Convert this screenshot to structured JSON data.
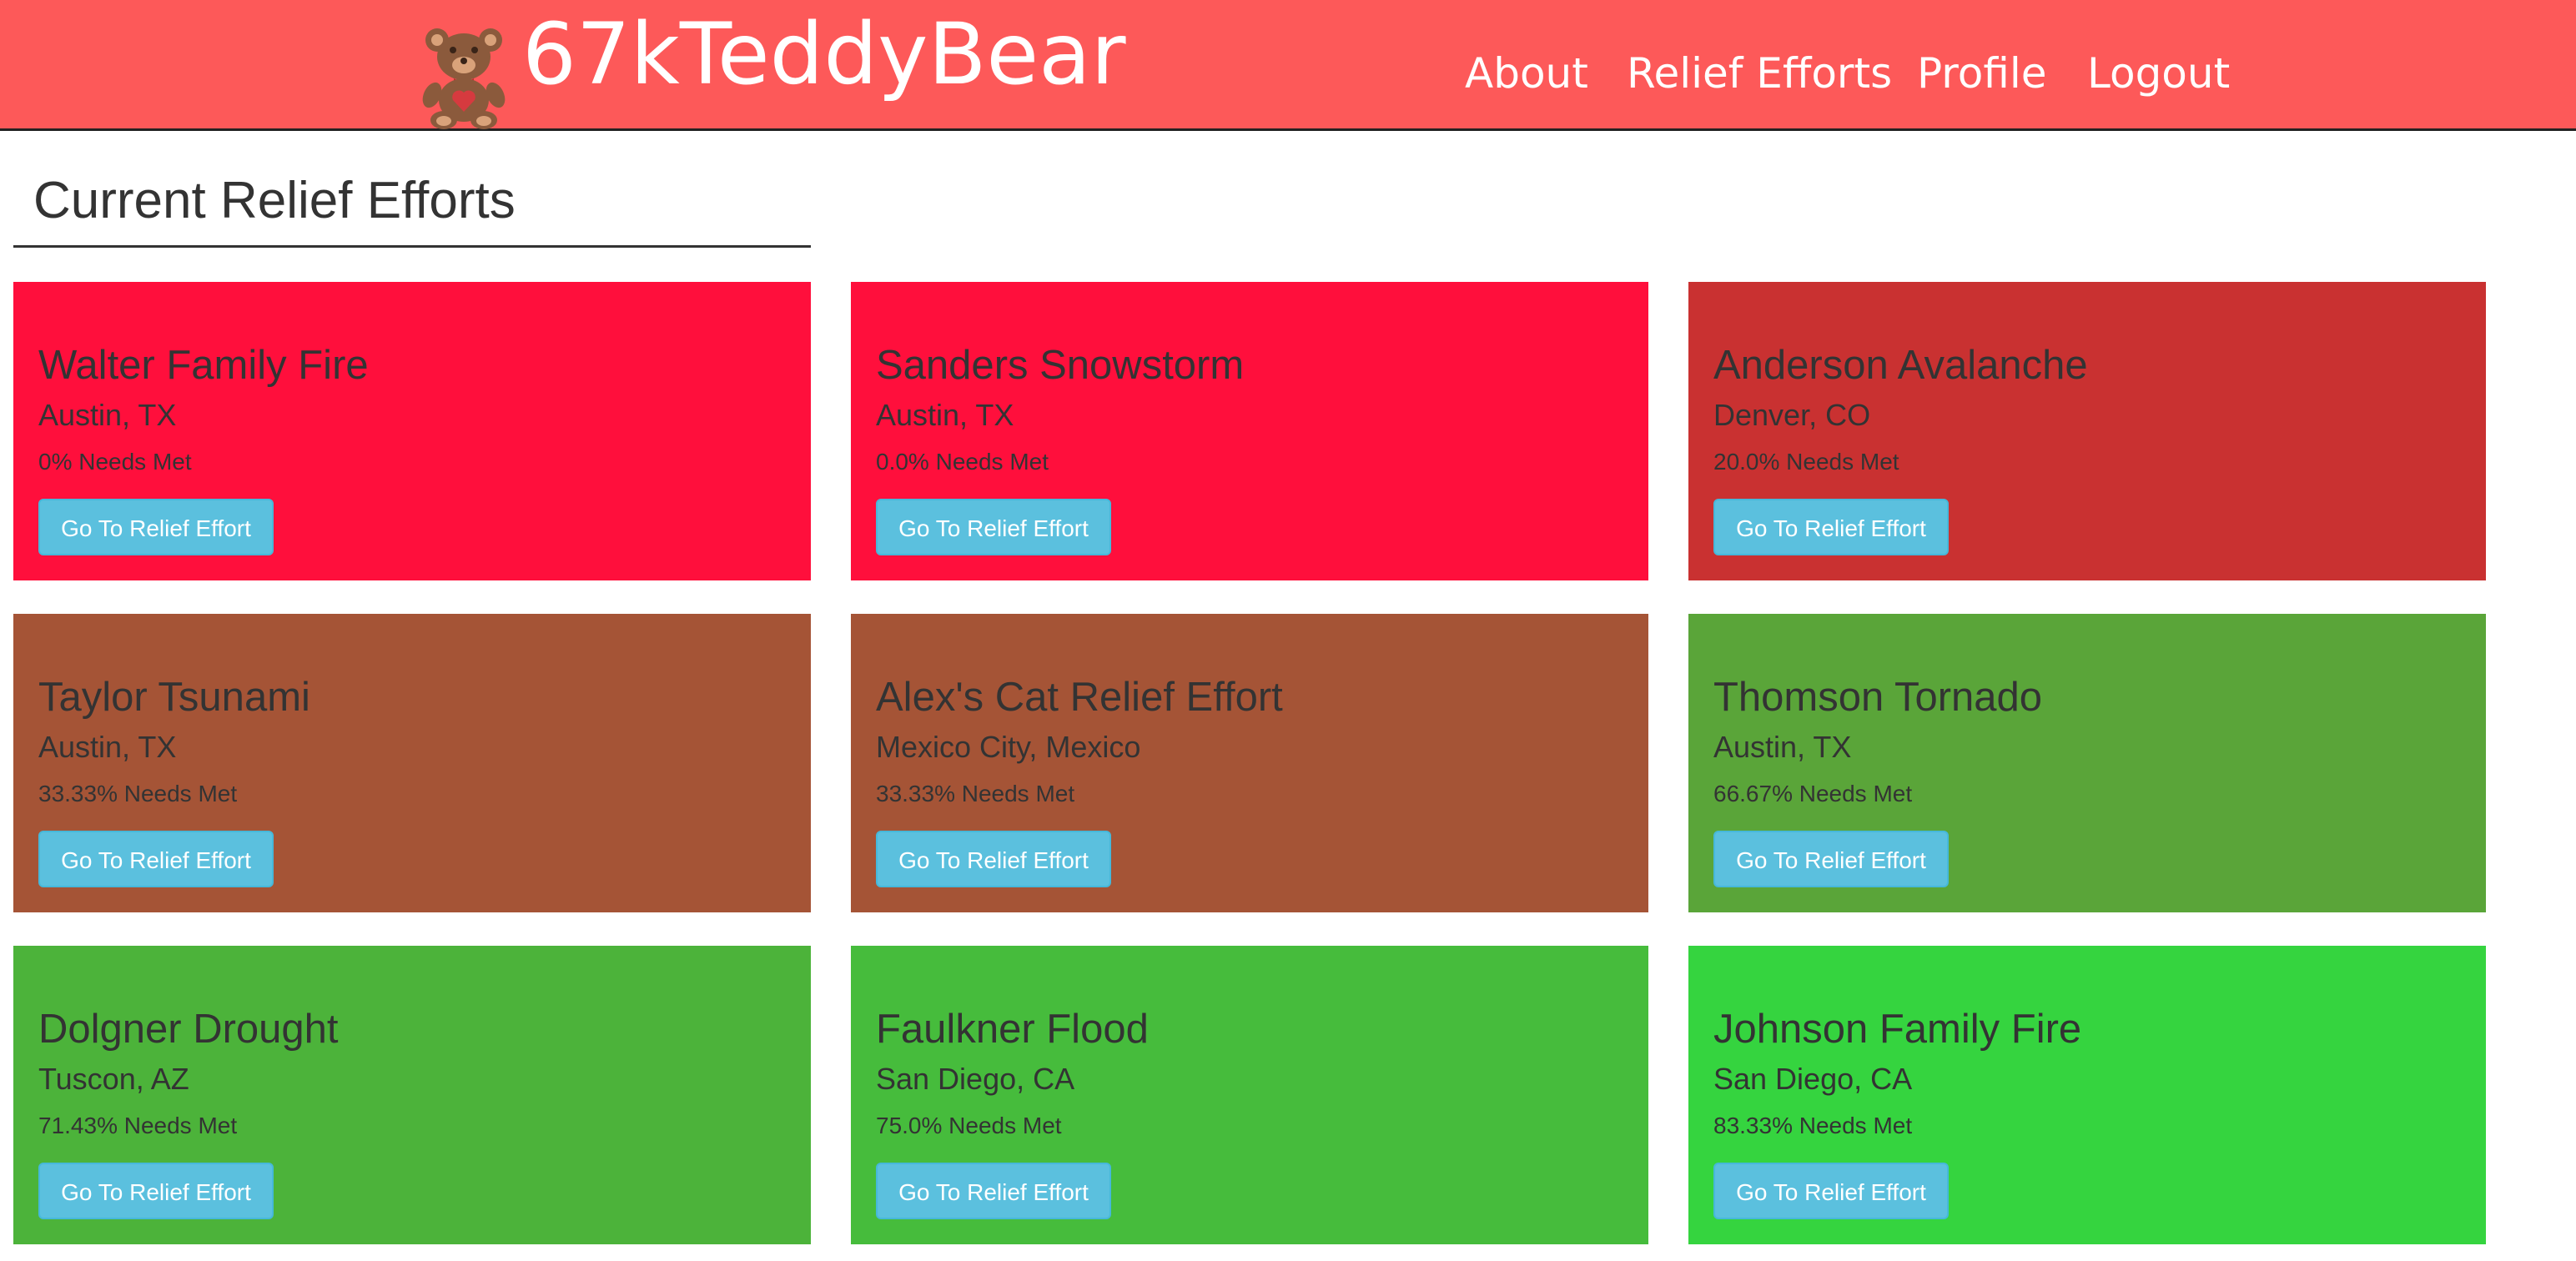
{
  "header": {
    "brand": "67kTeddyBear",
    "nav": [
      {
        "label": "About"
      },
      {
        "label": "Relief Efforts"
      },
      {
        "label": "Profile"
      },
      {
        "label": "Logout"
      }
    ]
  },
  "main": {
    "title": "Current Relief Efforts",
    "cards": [
      {
        "title": "Walter Family Fire",
        "location": "Austin, TX",
        "needs": "0% Needs Met",
        "button": "Go To Relief Effort",
        "color": "#ff0f3c"
      },
      {
        "title": "Sanders Snowstorm",
        "location": "Austin, TX",
        "needs": "0.0% Needs Met",
        "button": "Go To Relief Effort",
        "color": "#ff0f3c"
      },
      {
        "title": "Anderson Avalanche",
        "location": "Denver, CO",
        "needs": "20.0% Needs Met",
        "button": "Go To Relief Effort",
        "color": "#c93131"
      },
      {
        "title": "Taylor Tsunami",
        "location": "Austin, TX",
        "needs": "33.33% Needs Met",
        "button": "Go To Relief Effort",
        "color": "#a55436"
      },
      {
        "title": "Alex's Cat Relief Effort",
        "location": "Mexico City, Mexico",
        "needs": "33.33% Needs Met",
        "button": "Go To Relief Effort",
        "color": "#a55436"
      },
      {
        "title": "Thomson Tornado",
        "location": "Austin, TX",
        "needs": "66.67% Needs Met",
        "button": "Go To Relief Effort",
        "color": "#5aa539"
      },
      {
        "title": "Dolgner Drought",
        "location": "Tuscon, AZ",
        "needs": "71.43% Needs Met",
        "button": "Go To Relief Effort",
        "color": "#4cb33a"
      },
      {
        "title": "Faulkner Flood",
        "location": "San Diego, CA",
        "needs": "75.0% Needs Met",
        "button": "Go To Relief Effort",
        "color": "#46bc3c"
      },
      {
        "title": "Johnson Family Fire",
        "location": "San Diego, CA",
        "needs": "83.33% Needs Met",
        "button": "Go To Relief Effort",
        "color": "#35d43f"
      }
    ]
  },
  "colors": {
    "navbar": "#fd5959",
    "button": "#5bc0de"
  },
  "icons": {
    "logo": "teddy-bear-logo-icon"
  }
}
